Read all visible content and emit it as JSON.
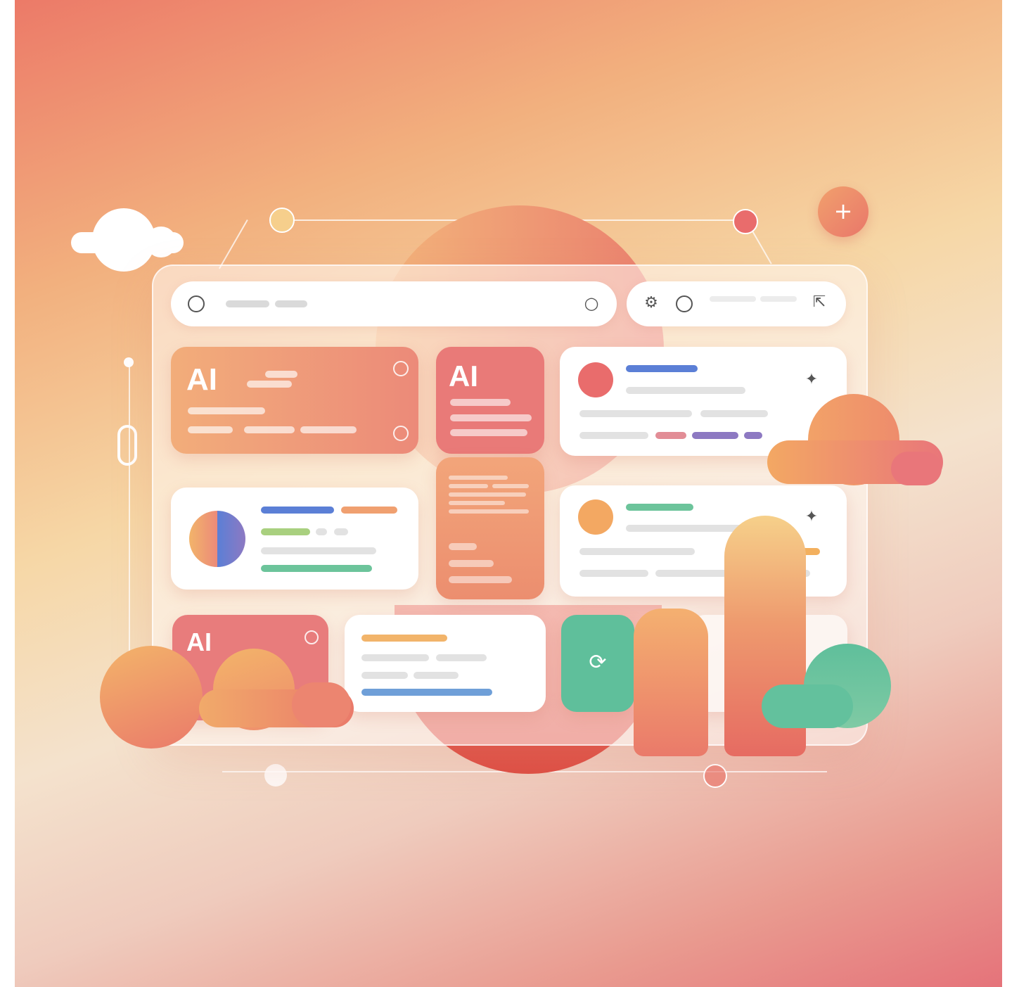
{
  "cards": {
    "top_left": {
      "label": "AI"
    },
    "top_middle": {
      "label": "AI"
    },
    "bottom_left": {
      "label": "AI"
    }
  },
  "colors": {
    "accent_coral": "#e9787a",
    "accent_orange": "#f0a070",
    "accent_teal": "#5fbf9b",
    "accent_blue": "#5b7fd6",
    "accent_purple": "#8d79c2",
    "accent_green": "#a9d07f"
  },
  "icons": {
    "search": "search-icon",
    "globe": "globe-icon",
    "circle": "circle-icon",
    "export": "export-icon",
    "sparkle": "sparkle-icon",
    "plus": "plus-icon",
    "refresh": "refresh-icon"
  }
}
